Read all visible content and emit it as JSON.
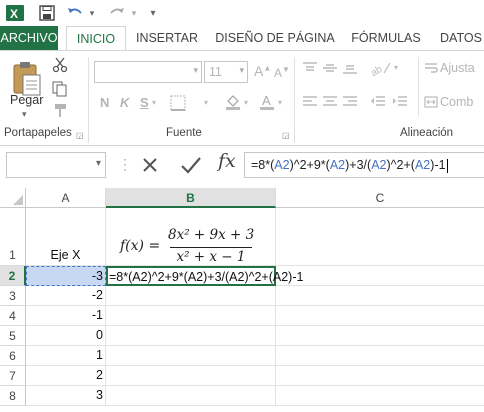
{
  "ribbon": {
    "tabs": [
      "ARCHIVO",
      "INICIO",
      "INSERTAR",
      "DISEÑO DE PÁGINA",
      "FÓRMULAS",
      "DATOS"
    ],
    "active_tab": "INICIO",
    "clipboard": {
      "paste_label": "Pegar",
      "group_label": "Portapapeles"
    },
    "font": {
      "size": "11",
      "group_label": "Fuente",
      "size_up": "A",
      "size_down": "A",
      "bold": "N",
      "italic": "K",
      "underline": "S"
    },
    "alignment": {
      "group_label": "Alineación",
      "wrap_label": "Ajusta",
      "merge_label": "Comb"
    }
  },
  "formula_bar": {
    "name_box": "",
    "fx": "fx",
    "formula_parts": [
      {
        "t": "=8*(",
        "ref": false
      },
      {
        "t": "A2",
        "ref": true
      },
      {
        "t": ")^2+9*(",
        "ref": false
      },
      {
        "t": "A2",
        "ref": true
      },
      {
        "t": ")+3/(",
        "ref": false
      },
      {
        "t": "A2",
        "ref": true
      },
      {
        "t": ")^2+(",
        "ref": false
      },
      {
        "t": "A2",
        "ref": true
      },
      {
        "t": ")-1",
        "ref": false
      }
    ]
  },
  "sheet": {
    "columns": [
      "A",
      "B",
      "C"
    ],
    "rows": [
      "1",
      "2",
      "3",
      "4",
      "5",
      "6",
      "7",
      "8"
    ],
    "a1": "Eje X",
    "a_values": [
      "-3",
      "-2",
      "-1",
      "0",
      "1",
      "2",
      "3"
    ],
    "b2": "=8*(A2)^2+9*(A2)+3/(A2)^2+(A2)-1",
    "equation": {
      "lhs": "f(x) =",
      "numerator": "8x² + 9x + 3",
      "denominator": "x² + x − 1"
    }
  },
  "colors": {
    "accent": "#217346",
    "selection": "#c6d8f4",
    "reference": "#4472c4"
  }
}
